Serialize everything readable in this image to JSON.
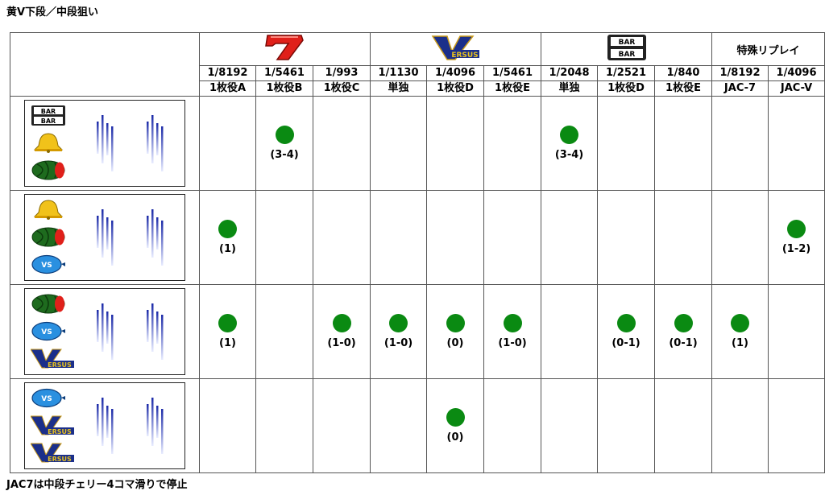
{
  "title": "黄V下段／中段狙い",
  "footnote": "JAC7は中段チェリー4コマ滑りで停止",
  "groups": [
    {
      "name": "seven-group",
      "symbol": "7",
      "span": 3
    },
    {
      "name": "versus-group",
      "symbol": "VERSUS",
      "span": 3
    },
    {
      "name": "bar-group",
      "symbol": "BAR BAR",
      "span": 3
    },
    {
      "name": "special-replay-group",
      "label": "特殊リプレイ",
      "span": 2
    }
  ],
  "columns": [
    {
      "prob": "1/8192",
      "role": "1枚役A"
    },
    {
      "prob": "1/5461",
      "role": "1枚役B"
    },
    {
      "prob": "1/993",
      "role": "1枚役C"
    },
    {
      "prob": "1/1130",
      "role": "単独"
    },
    {
      "prob": "1/4096",
      "role": "1枚役D"
    },
    {
      "prob": "1/5461",
      "role": "1枚役E"
    },
    {
      "prob": "1/2048",
      "role": "単独"
    },
    {
      "prob": "1/2521",
      "role": "1枚役D"
    },
    {
      "prob": "1/840",
      "role": "1枚役E"
    },
    {
      "prob": "1/8192",
      "role": "JAC-7"
    },
    {
      "prob": "1/4096",
      "role": "JAC-V"
    }
  ],
  "rows": [
    {
      "symbols": [
        "bar-icon",
        "bell-icon",
        "watermelon-icon"
      ],
      "hits": [
        null,
        "(3-4)",
        null,
        null,
        null,
        null,
        "(3-4)",
        null,
        null,
        null,
        null
      ]
    },
    {
      "symbols": [
        "bell-icon",
        "watermelon-icon",
        "vs-plum-icon"
      ],
      "hits": [
        "(1)",
        null,
        null,
        null,
        null,
        null,
        null,
        null,
        null,
        null,
        "(1-2)"
      ]
    },
    {
      "symbols": [
        "watermelon-icon",
        "vs-plum-icon",
        "versus-v-icon"
      ],
      "hits": [
        "(1)",
        null,
        "(1-0)",
        "(1-0)",
        "(0)",
        "(1-0)",
        null,
        "(0-1)",
        "(0-1)",
        "(1)",
        null
      ]
    },
    {
      "symbols": [
        "vs-plum-icon",
        "versus-v-icon",
        "versus-v-icon"
      ],
      "hits": [
        null,
        null,
        null,
        null,
        "(0)",
        null,
        null,
        null,
        null,
        null,
        null
      ]
    }
  ],
  "svgtext": {
    "bar": "BAR",
    "vs": "VS",
    "ersus": "ERSUS",
    "seven": "7"
  },
  "colors": {
    "hit": "#0a8a12",
    "seven": "#e0201a",
    "versus": "#1b2f8a",
    "reel_line": "#3a4fbf"
  }
}
